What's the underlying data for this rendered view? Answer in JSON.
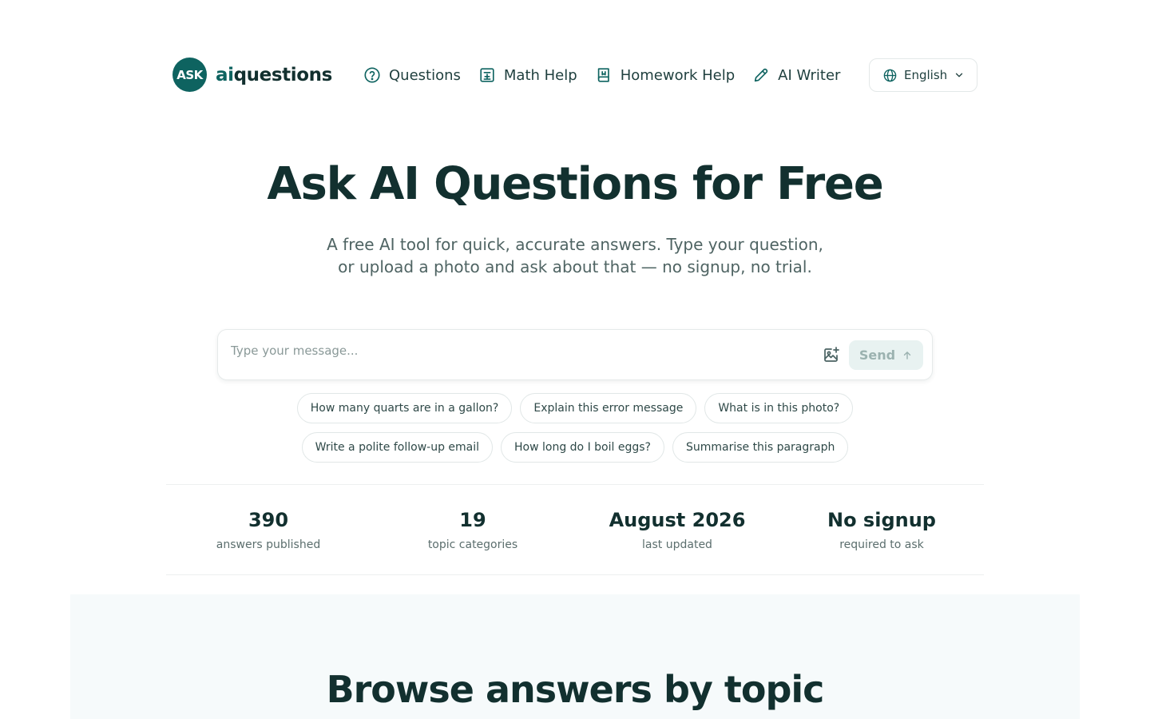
{
  "brand": {
    "badge": "ASK",
    "name_prefix": "ai",
    "name_suffix": "questions",
    "color": "#0e6360"
  },
  "nav": [
    {
      "label": "Questions",
      "icon": "question-circle-icon"
    },
    {
      "label": "Math Help",
      "icon": "calculator-icon"
    },
    {
      "label": "Homework Help",
      "icon": "book-icon"
    },
    {
      "label": "AI Writer",
      "icon": "pencil-icon"
    }
  ],
  "language": {
    "label": "English"
  },
  "hero": {
    "title": "Ask AI Questions for Free",
    "subtitle_line1": "A free AI tool for quick, accurate answers. Type your question,",
    "subtitle_line2": "or upload a photo and ask about that — no signup, no trial."
  },
  "chat": {
    "placeholder": "Type your message...",
    "send_label": "Send"
  },
  "suggestions": [
    "How many quarts are in a gallon?",
    "Explain this error message",
    "What is in this photo?",
    "Write a polite follow-up email",
    "How long do I boil eggs?",
    "Summarise this paragraph"
  ],
  "stats": [
    {
      "value": "390",
      "label": "answers published"
    },
    {
      "value": "19",
      "label": "topic categories"
    },
    {
      "value": "August 2026",
      "label": "last updated"
    },
    {
      "value": "No signup",
      "label": "required to ask"
    }
  ],
  "browse": {
    "title": "Browse answers by topic"
  }
}
